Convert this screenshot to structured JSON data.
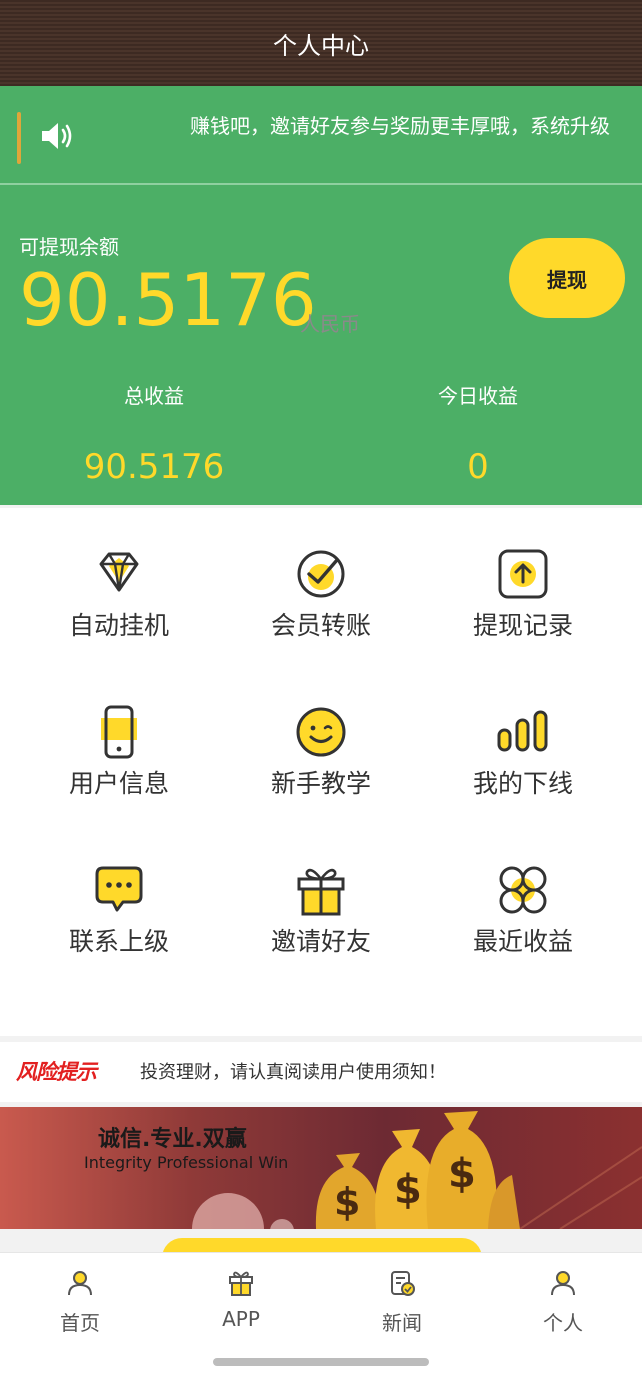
{
  "header": {
    "title": "个人中心"
  },
  "marquee": {
    "text": "赚钱吧，邀请好友参与奖励更丰厚哦，系统升级"
  },
  "balance": {
    "label": "可提现余额",
    "value": "90.5176",
    "unit": "人民币",
    "withdraw_label": "提现"
  },
  "stats": {
    "total": {
      "label": "总收益",
      "value": "90.5176"
    },
    "today": {
      "label": "今日收益",
      "value": "0"
    }
  },
  "grid": {
    "items": [
      {
        "label": "自动挂机",
        "icon": "diamond-icon"
      },
      {
        "label": "会员转账",
        "icon": "check-circle-icon"
      },
      {
        "label": "提现记录",
        "icon": "upload-record-icon"
      },
      {
        "label": "用户信息",
        "icon": "phone-icon"
      },
      {
        "label": "新手教学",
        "icon": "smiley-icon"
      },
      {
        "label": "我的下线",
        "icon": "bars-icon"
      },
      {
        "label": "联系上级",
        "icon": "chat-bubble-icon"
      },
      {
        "label": "邀请好友",
        "icon": "gift-icon"
      },
      {
        "label": "最近收益",
        "icon": "clover-icon"
      }
    ]
  },
  "notice": {
    "label": "风险提示",
    "text": "投资理财，请认真阅读用户使用须知！"
  },
  "banner": {
    "cn": "诚信.专业.双赢",
    "en": "Integrity Professional Win"
  },
  "tabs": [
    {
      "label": "首页",
      "icon": "user-icon"
    },
    {
      "label": "APP",
      "icon": "gift-icon"
    },
    {
      "label": "新闻",
      "icon": "news-icon"
    },
    {
      "label": "个人",
      "icon": "user-icon"
    }
  ],
  "colors": {
    "green": "#4caf66",
    "yellow": "#ffd92a",
    "header": "#3d2a22",
    "risk": "#e22020"
  }
}
